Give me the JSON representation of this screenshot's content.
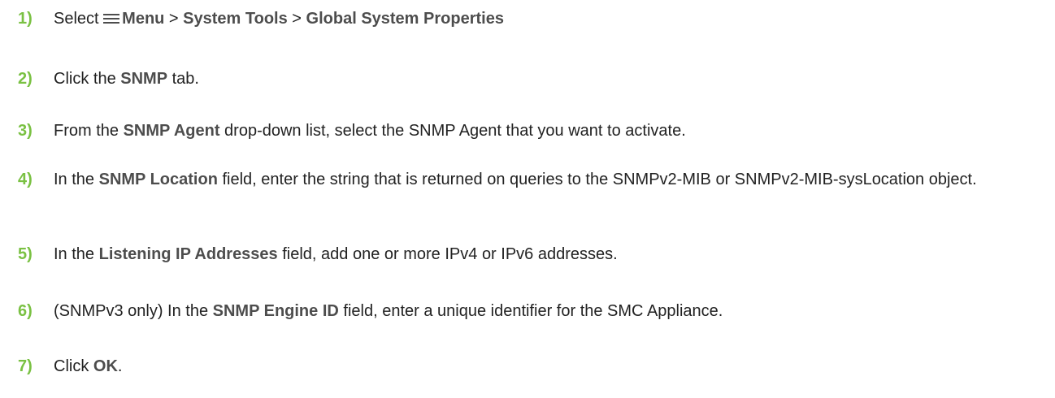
{
  "accent_color": "#7ac143",
  "steps": [
    {
      "number": "1)",
      "parts": {
        "t1": "Select ",
        "icon": "hamburger-menu-icon",
        "b1": "Menu",
        "t2": " > ",
        "b2": "System Tools",
        "t3": " > ",
        "b3": "Global System Properties"
      }
    },
    {
      "number": "2)",
      "parts": {
        "t1": "Click the ",
        "b1": "SNMP",
        "t2": " tab."
      }
    },
    {
      "number": "3)",
      "parts": {
        "t1": "From the ",
        "b1": "SNMP Agent",
        "t2": " drop-down list, select the SNMP Agent that you want to activate."
      }
    },
    {
      "number": "4)",
      "parts": {
        "t1": "In the ",
        "b1": "SNMP Location",
        "t2": " field, enter the string that is returned on queries to the SNMPv2-MIB or SNMPv2-MIB-sysLocation object."
      }
    },
    {
      "number": "5)",
      "parts": {
        "t1": "In the ",
        "b1": "Listening IP Addresses",
        "t2": " field, add one or more IPv4 or IPv6 addresses."
      }
    },
    {
      "number": "6)",
      "parts": {
        "t1": "(SNMPv3 only) In the ",
        "b1": "SNMP Engine ID",
        "t2": " field, enter a unique identifier for the SMC Appliance."
      }
    },
    {
      "number": "7)",
      "parts": {
        "t1": "Click ",
        "b1": "OK",
        "t2": "."
      }
    }
  ]
}
